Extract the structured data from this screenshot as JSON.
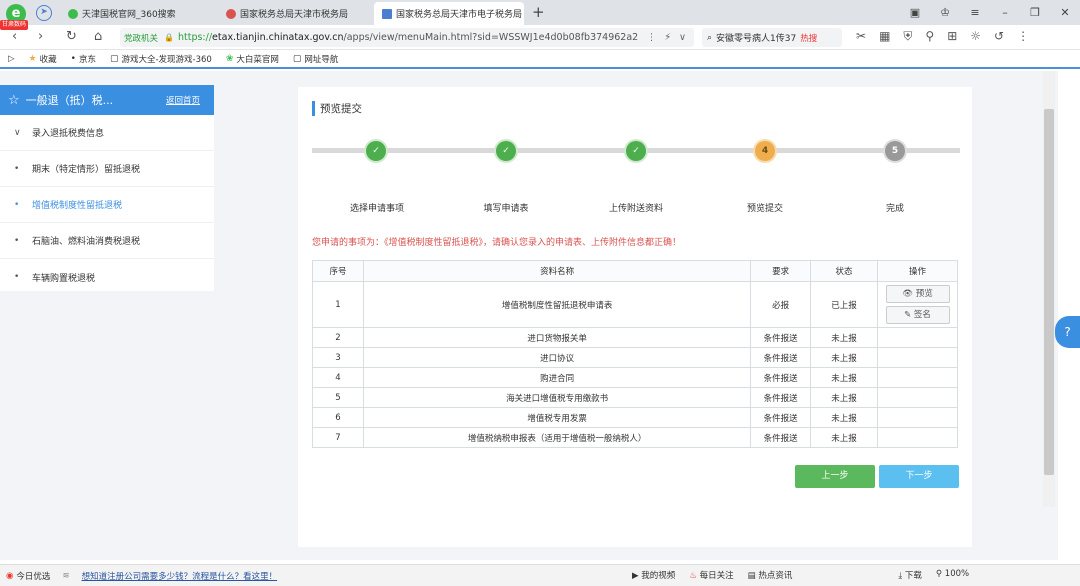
{
  "browser": {
    "logo_badge": "甘肃数码",
    "tabs": [
      {
        "title": "天津国税官网_360搜索",
        "favicon_color": "#3dbb4c",
        "active": false
      },
      {
        "title": "国家税务总局天津市税务局",
        "favicon_color": "#d9534f",
        "active": false
      },
      {
        "title": "国家税务总局天津市电子税务局",
        "favicon_color": "#4a7fd0",
        "active": true
      }
    ],
    "new_tab": "+",
    "address": {
      "site_badge": "党政机关",
      "protocol": "https://",
      "host": "etax.tianjin.chinatax.gov.cn",
      "path": "/apps/view/menuMain.html?sid=WSSWJ1e4d0b08fb374962a2"
    },
    "search": {
      "text": "安徽零号病人1传37",
      "hot": "热搜"
    },
    "bookmarks": [
      "收藏",
      "京东",
      "游戏大全-发现游戏-360",
      "大白菜官网",
      "网址导航"
    ]
  },
  "sidebar": {
    "title": "一般退（抵）税...",
    "back_link": "返回首页",
    "items": [
      {
        "label": "录入退抵税费信息",
        "marker": "∨",
        "active": false
      },
      {
        "label": "期末（特定情形）留抵退税",
        "marker": "•",
        "active": false
      },
      {
        "label": "增值税制度性留抵退税",
        "marker": "•",
        "active": true
      },
      {
        "label": "石脑油、燃料油消费税退税",
        "marker": "•",
        "active": false
      },
      {
        "label": "车辆购置税退税",
        "marker": "•",
        "active": false
      }
    ]
  },
  "main": {
    "section_title": "预览提交",
    "steps": [
      {
        "label": "选择申请事项",
        "state": "done",
        "mark": "✓"
      },
      {
        "label": "填写申请表",
        "state": "done",
        "mark": "✓"
      },
      {
        "label": "上传附送资料",
        "state": "done",
        "mark": "✓"
      },
      {
        "label": "预览提交",
        "state": "current",
        "mark": "4"
      },
      {
        "label": "完成",
        "state": "todo",
        "mark": "5"
      }
    ],
    "notice": "您申请的事项为：《增值税制度性留抵退税》，请确认您录入的申请表、上传附件信息都正确！",
    "table": {
      "headers": [
        "序号",
        "资料名称",
        "要求",
        "状态",
        "操作"
      ],
      "rows": [
        {
          "no": "1",
          "name": "增值税制度性留抵退税申请表",
          "req": "必报",
          "status": "已上报"
        },
        {
          "no": "2",
          "name": "进口货物报关单",
          "req": "条件报送",
          "status": "未上报"
        },
        {
          "no": "3",
          "name": "进口协议",
          "req": "条件报送",
          "status": "未上报"
        },
        {
          "no": "4",
          "name": "购进合同",
          "req": "条件报送",
          "status": "未上报"
        },
        {
          "no": "5",
          "name": "海关进口增值税专用缴款书",
          "req": "条件报送",
          "status": "未上报"
        },
        {
          "no": "6",
          "name": "增值税专用发票",
          "req": "条件报送",
          "status": "未上报"
        },
        {
          "no": "7",
          "name": "增值税纳税申报表（适用于增值税一般纳税人）",
          "req": "条件报送",
          "status": "未上报"
        }
      ],
      "preview_btn": "预览",
      "sign_btn": "签名"
    },
    "prev_btn": "上一步",
    "next_btn": "下一步"
  },
  "statusbar": {
    "left": "今日优选",
    "link": "想知道注册公司需要多少钱？流程是什么？看这里！",
    "right": [
      "我的视频",
      "每日关注",
      "热点资讯",
      "下载",
      "100%"
    ]
  }
}
